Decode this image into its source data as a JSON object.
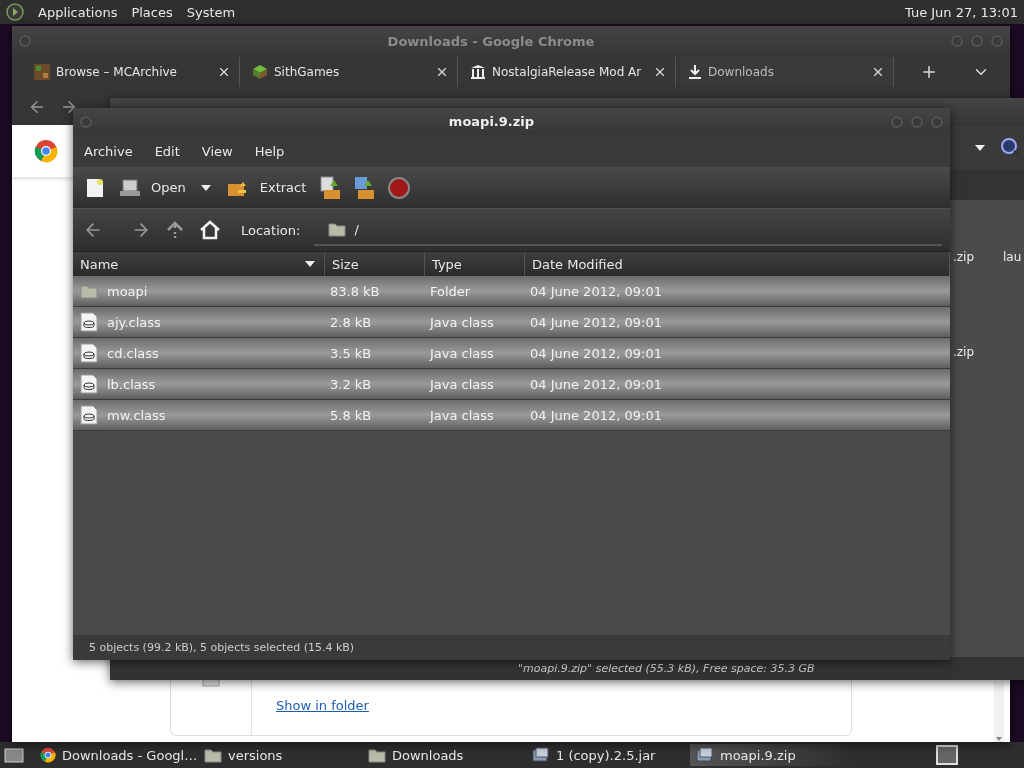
{
  "top_panel": {
    "menus": [
      "Applications",
      "Places",
      "System"
    ],
    "clock": "Tue Jun 27, 13:01"
  },
  "chrome": {
    "title": "Downloads - Google Chrome",
    "tabs": [
      {
        "kind": "grid",
        "label": "Browse – MCArchive",
        "selected": false
      },
      {
        "kind": "cube",
        "label": "SithGames",
        "selected": false
      },
      {
        "kind": "museum",
        "label": "NostalgiaRelease Mod Ar",
        "selected": false
      },
      {
        "kind": "download",
        "label": "Downloads",
        "selected": true
      }
    ],
    "link": "Show in folder"
  },
  "file_manager": {
    "labels": [
      ".zip",
      "lau",
      ".zip"
    ],
    "status": "\"moapi.9.zip\" selected (55.3 kB), Free space: 35.3 GB"
  },
  "archive": {
    "title": "moapi.9.zip",
    "menu": [
      "Archive",
      "Edit",
      "View",
      "Help"
    ],
    "open": "Open",
    "extract": "Extract",
    "location_label": "Location:",
    "location": "/",
    "columns": [
      "Name",
      "Size",
      "Type",
      "Date Modified"
    ],
    "rows": [
      {
        "kind": "folder",
        "name": "moapi",
        "size": "83.8 kB",
        "type": "Folder",
        "date": "04 June 2012, 09:01",
        "selected": true
      },
      {
        "kind": "class",
        "name": "ajy.class",
        "size": "2.8 kB",
        "type": "Java class",
        "date": "04 June 2012, 09:01",
        "selected": true
      },
      {
        "kind": "class",
        "name": "cd.class",
        "size": "3.5 kB",
        "type": "Java class",
        "date": "04 June 2012, 09:01",
        "selected": true
      },
      {
        "kind": "class",
        "name": "lb.class",
        "size": "3.2 kB",
        "type": "Java class",
        "date": "04 June 2012, 09:01",
        "selected": true
      },
      {
        "kind": "class",
        "name": "mw.class",
        "size": "5.8 kB",
        "type": "Java class",
        "date": "04 June 2012, 09:01",
        "selected": true
      }
    ],
    "status": "5 objects (99.2 kB), 5 objects selected (15.4 kB)"
  },
  "taskbar": [
    {
      "kind": "browser",
      "label": "Downloads - Googl…",
      "selected": false
    },
    {
      "kind": "folder",
      "label": "versions",
      "selected": false
    },
    {
      "kind": "folder",
      "label": "Downloads",
      "selected": false
    },
    {
      "kind": "archive",
      "label": "1 (copy).2.5.jar",
      "selected": false
    },
    {
      "kind": "archive",
      "label": "moapi.9.zip",
      "selected": true
    }
  ]
}
